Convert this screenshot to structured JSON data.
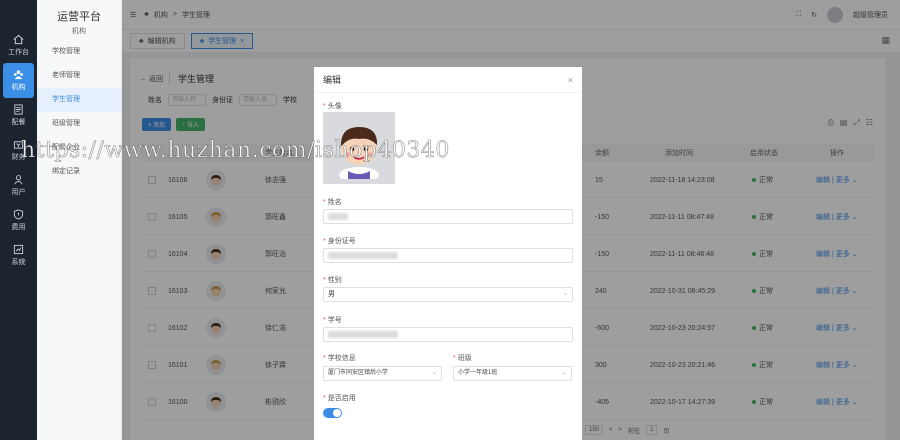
{
  "rail": [
    {
      "label": "工作台",
      "icon": "home-icon"
    },
    {
      "label": "机构",
      "icon": "org-icon",
      "active": true
    },
    {
      "label": "配餐",
      "icon": "doc-icon"
    },
    {
      "label": "财务",
      "icon": "money-icon"
    },
    {
      "label": "用户",
      "icon": "user-icon"
    },
    {
      "label": "费用",
      "icon": "shield-icon"
    },
    {
      "label": "系统",
      "icon": "settings-icon"
    }
  ],
  "brand": {
    "title": "运营平台",
    "subtitle": "机构"
  },
  "menu": [
    {
      "label": "学校管理"
    },
    {
      "label": "老师管理"
    },
    {
      "label": "学生管理",
      "active": true
    },
    {
      "label": "班级管理"
    },
    {
      "label": "配餐企业"
    },
    {
      "label": "绑定记录"
    }
  ],
  "breadcrumb": [
    "机构",
    "学生管理"
  ],
  "user": {
    "name": "超级管理员"
  },
  "tabs": [
    {
      "label": "编辑机构"
    },
    {
      "label": "学生管理",
      "active": true
    }
  ],
  "page": {
    "back": "返回",
    "title": "学生管理"
  },
  "filters": [
    {
      "label": "姓名",
      "placeholder": "请输入姓"
    },
    {
      "label": "身份证",
      "placeholder": "请输入身"
    },
    {
      "label": "学校"
    }
  ],
  "buttons": {
    "add": "+ 添加",
    "import": "导入"
  },
  "table": {
    "headers": [
      "学生姓名",
      "余额",
      "添加时间",
      "启用状态",
      "操作"
    ],
    "rows": [
      {
        "id": "16106",
        "name": "徐志强",
        "balance": "15",
        "time": "2022-11-18 14:23:08",
        "status": "正常"
      },
      {
        "id": "16105",
        "name": "郭旺鑫",
        "balance": "-150",
        "time": "2022-11-11 08:47:48",
        "status": "正常"
      },
      {
        "id": "16104",
        "name": "郭旺治",
        "balance": "-150",
        "time": "2022-11-11 08:46:48",
        "status": "正常"
      },
      {
        "id": "16103",
        "name": "何家允",
        "balance": "240",
        "time": "2022-10-31 08:45:29",
        "status": "正常"
      },
      {
        "id": "16102",
        "name": "徐仁浩",
        "balance": "-600",
        "time": "2022-10-23 20:24:57",
        "status": "正常"
      },
      {
        "id": "16101",
        "name": "徐子霖",
        "balance": "300",
        "time": "2022-10-23 20:21:46",
        "status": "正常"
      },
      {
        "id": "16100",
        "name": "彬锐欣",
        "balance": "-405",
        "time": "2022-10-17 14:27:39",
        "status": "正常"
      }
    ],
    "edit": "编辑",
    "more": "更多"
  },
  "pager": {
    "size": "150",
    "goto": "前往",
    "page": "1",
    "unit": "页"
  },
  "dialog": {
    "title": "编辑",
    "avatar_label": "头像",
    "name_label": "姓名",
    "id_label": "身份证号",
    "gender_label": "性别",
    "gender_value": "男",
    "student_no_label": "学号",
    "school_label": "学校信息",
    "school_value": "厦门市同安区镇后小学",
    "class_label": "班级",
    "class_value": "小学一年级1班",
    "enabled_label": "是否启用"
  },
  "watermark": "https://www.huzhan.com/ishop40340"
}
